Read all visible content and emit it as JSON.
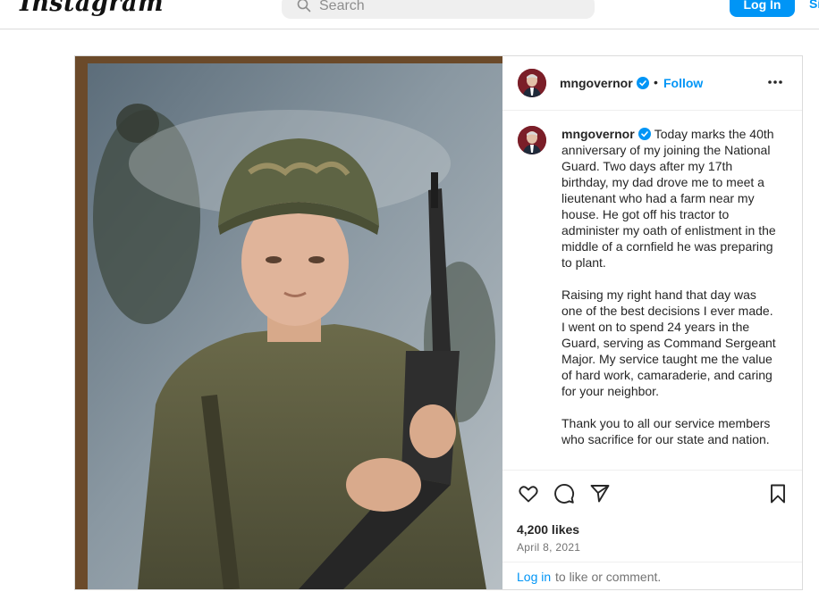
{
  "header": {
    "logo_text": "Instagram",
    "search_placeholder": "Search",
    "login_label": "Log In",
    "signup_label": "Sign Up"
  },
  "post": {
    "username": "mngovernor",
    "follow_label": "Follow",
    "separator": "•",
    "caption_paragraphs": [
      "Today marks the 40th anniversary of my joining the National Guard. Two days after my 17th birthday, my dad drove me to meet a lieutenant who had a farm near my house. He got off his tractor to administer my oath of enlistment in the middle of a cornfield he was preparing to plant.",
      "Raising my right hand that day was one of the best decisions I ever made. I went on to spend 24 years in the Guard, serving as Command Sergeant Major. My service taught me the value of hard work, camaraderie, and caring for your neighbor.",
      "Thank you to all our service members who sacrifice for our state and nation."
    ],
    "likes": "4,200 likes",
    "date": "April 8, 2021",
    "comment_login": "Log in",
    "comment_prompt": "to like or comment."
  },
  "icons": [
    "search-icon",
    "verified-icon",
    "more-options-icon",
    "heart-icon",
    "comment-icon",
    "share-icon",
    "bookmark-icon"
  ],
  "colors": {
    "accent": "#0095f6",
    "border": "#dbdbdb",
    "text": "#262626",
    "muted": "#737373"
  }
}
